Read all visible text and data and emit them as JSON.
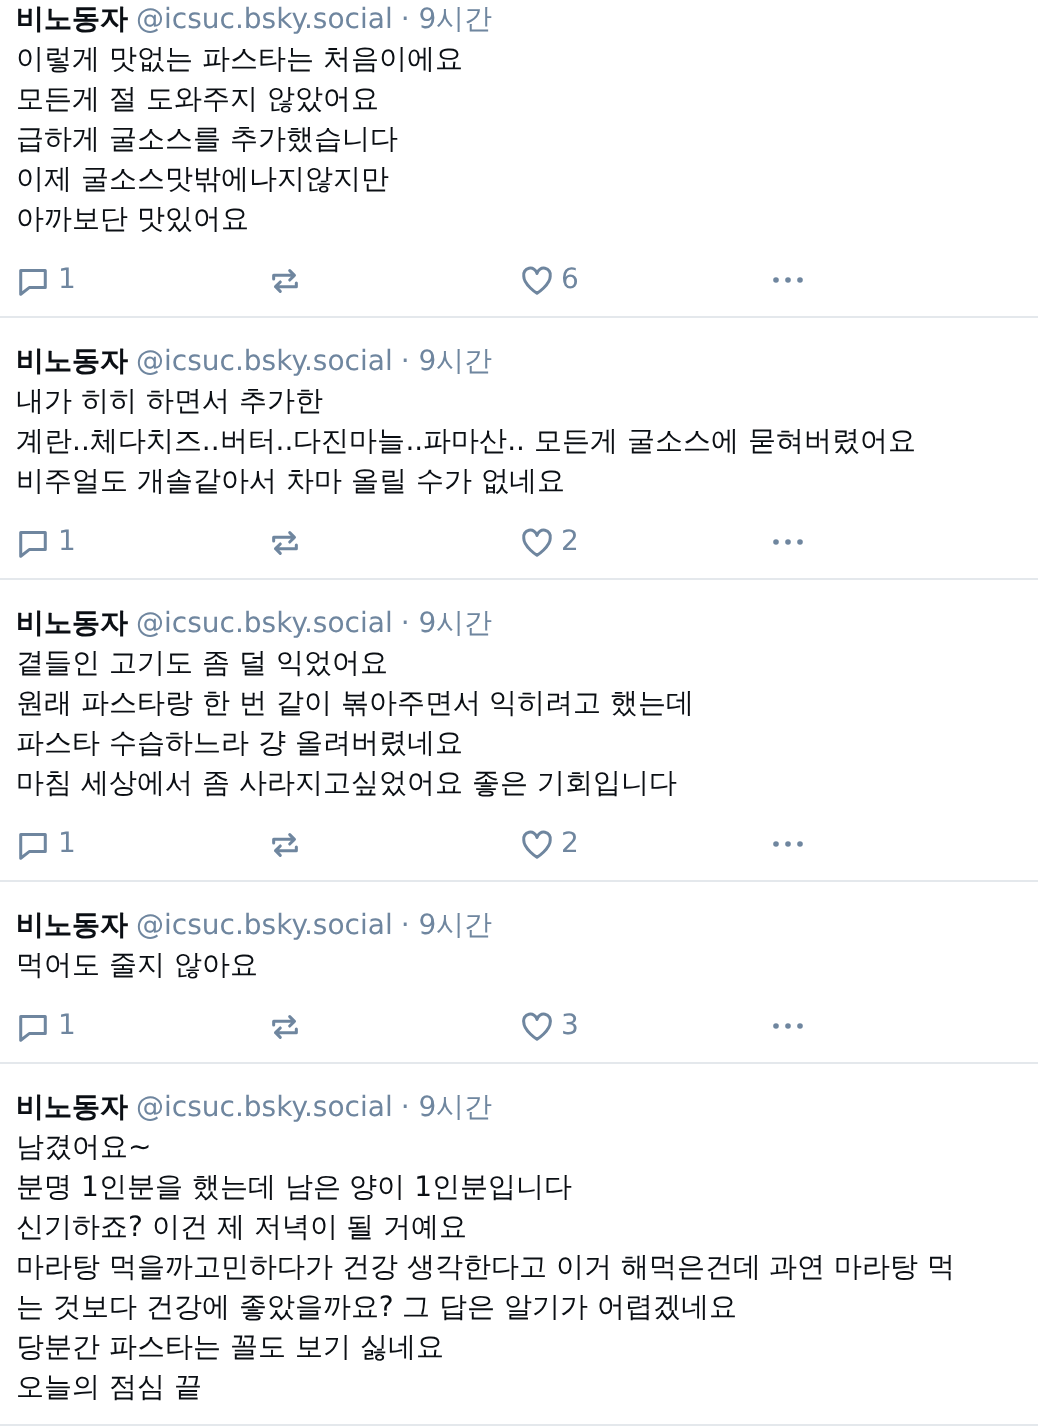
{
  "posts": [
    {
      "author": "비노동자",
      "handle": "@icsuc.bsky.social",
      "time": "· 9시간",
      "lines": [
        "이렇게 맛없는 파스타는 처음이에요",
        "모든게 절 도와주지 않았어요",
        "급하게 굴소스를 추가했습니다",
        "이제 굴소스맛밖에나지않지만",
        "아까보단 맛있어요"
      ],
      "replies": "1",
      "likes": "6"
    },
    {
      "author": "비노동자",
      "handle": "@icsuc.bsky.social",
      "time": "· 9시간",
      "lines": [
        "내가 히히 하면서 추가한",
        "계란..체다치즈..버터..다진마늘..파마산.. 모든게 굴소스에 묻혀버렸어요",
        "비주얼도 개솔같아서 차마 올릴 수가 없네요"
      ],
      "replies": "1",
      "likes": "2"
    },
    {
      "author": "비노동자",
      "handle": "@icsuc.bsky.social",
      "time": "· 9시간",
      "lines": [
        "곁들인 고기도 좀 덜 익었어요",
        "원래 파스타랑 한 번 같이 볶아주면서 익히려고 했는데",
        "파스타 수습하느라 걍 올려버렸네요",
        "마침 세상에서 좀 사라지고싶었어요 좋은 기회입니다"
      ],
      "replies": "1",
      "likes": "2"
    },
    {
      "author": "비노동자",
      "handle": "@icsuc.bsky.social",
      "time": "· 9시간",
      "lines": [
        "먹어도 줄지 않아요"
      ],
      "replies": "1",
      "likes": "3"
    },
    {
      "author": "비노동자",
      "handle": "@icsuc.bsky.social",
      "time": "· 9시간",
      "lines": [
        "남겼어요~",
        "분명 1인분을 했는데 남은 양이 1인분입니다",
        "신기하죠? 이건 제 저녁이 될 거예요",
        "마라탕 먹을까고민하다가 건강 생각한다고 이거 해먹은건데 과연 마라탕 먹",
        "는 것보다 건강에 좋았을까요? 그 답은 알기가 어렵겠네요",
        "당분간 파스타는 꼴도 보기 싫네요",
        "오늘의 점심 끝"
      ]
    }
  ]
}
